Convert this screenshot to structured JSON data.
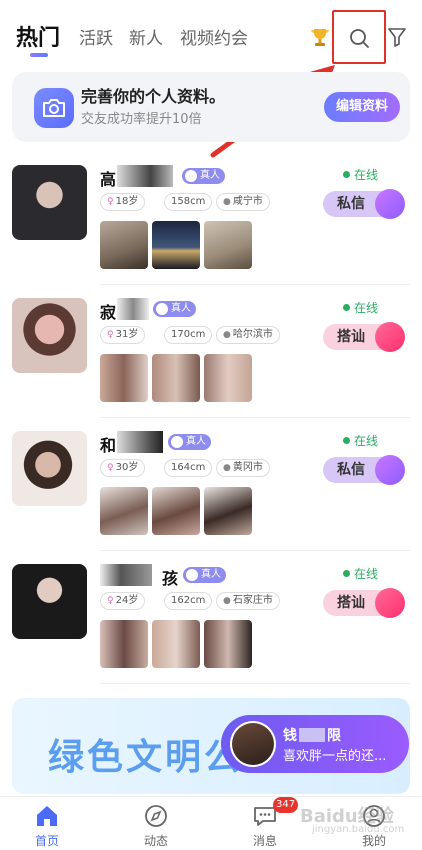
{
  "tabs": [
    {
      "label": "热门",
      "active": true
    },
    {
      "label": "活跃"
    },
    {
      "label": "新人"
    },
    {
      "label": "视频约会"
    }
  ],
  "header_icons": [
    "trophy-icon",
    "search-icon",
    "filter-icon"
  ],
  "banner": {
    "title": "完善你的个人资料。",
    "subtitle": "交友成功率提升10倍",
    "button": "编辑资料"
  },
  "users": [
    {
      "name_start": "高",
      "name_end": "",
      "badge": "真人",
      "age": "18岁",
      "height": "158cm",
      "city": "咸宁市",
      "online": "在线",
      "action": "私信",
      "action_type": "msg"
    },
    {
      "name_start": "寂",
      "name_end": "",
      "badge": "真人",
      "age": "31岁",
      "height": "170cm",
      "city": "哈尔滨市",
      "online": "在线",
      "action": "搭讪",
      "action_type": "greet"
    },
    {
      "name_start": "和",
      "name_end": "",
      "badge": "真人",
      "age": "30岁",
      "height": "164cm",
      "city": "黄冈市",
      "online": "在线",
      "action": "私信",
      "action_type": "msg"
    },
    {
      "name_start": "",
      "name_end": "孩",
      "badge": "真人",
      "age": "24岁",
      "height": "162cm",
      "city": "石家庄市",
      "online": "在线",
      "action": "搭讪",
      "action_type": "greet"
    }
  ],
  "promo": {
    "text": "绿色文明公"
  },
  "float_card": {
    "name_start": "钱",
    "name_end": "限",
    "message": "喜欢胖一点的还..."
  },
  "bottom_nav": [
    {
      "label": "首页",
      "icon": "home-icon",
      "active": true
    },
    {
      "label": "动态",
      "icon": "compass-icon"
    },
    {
      "label": "消息",
      "icon": "chat-icon",
      "badge": "347"
    },
    {
      "label": "我的",
      "icon": "profile-icon"
    }
  ],
  "watermark": {
    "text": "Baidu经验",
    "sub": "jingyan.baidu.com"
  },
  "colors": {
    "accent": "#5b6dff",
    "highlight_box": "#e0302a",
    "online": "#27ae60",
    "badge": "#e8342c"
  }
}
